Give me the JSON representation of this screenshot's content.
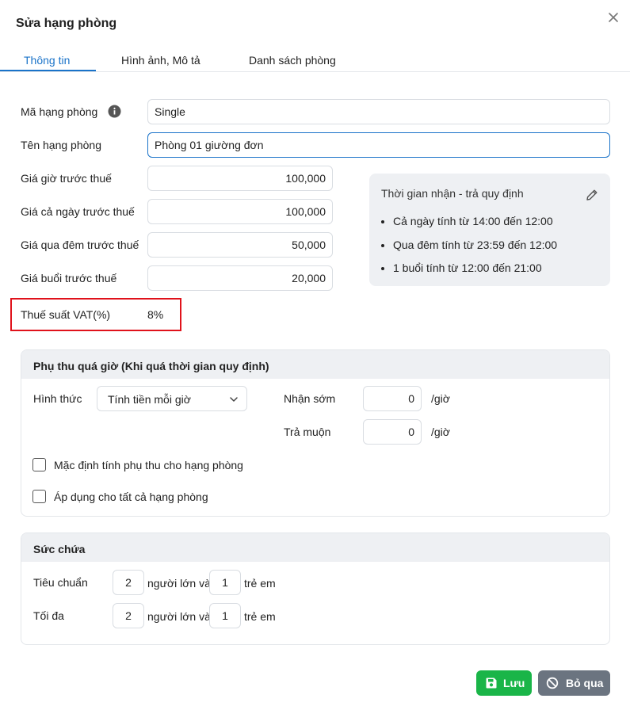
{
  "dialog": {
    "title": "Sửa hạng phòng"
  },
  "tabs": [
    {
      "label": "Thông tin"
    },
    {
      "label": "Hình ảnh, Mô tả"
    },
    {
      "label": "Danh sách phòng"
    }
  ],
  "form": {
    "code_label": "Mã hạng phòng",
    "code_value": "Single",
    "name_label": "Tên hạng phòng",
    "name_value": "Phòng 01 giường đơn",
    "hourly_label": "Giá giờ trước thuế",
    "hourly_value": "100,000",
    "daily_label": "Giá cả ngày trước thuế",
    "daily_value": "100,000",
    "overnight_label": "Giá qua đêm trước thuế",
    "overnight_value": "50,000",
    "session_label": "Giá buổi trước thuế",
    "session_value": "20,000",
    "vat_label": "Thuế suất VAT(%)",
    "vat_value": "8%"
  },
  "time_rules": {
    "title": "Thời gian nhận - trả quy định",
    "items": [
      "Cả ngày tính từ 14:00 đến 12:00",
      "Qua đêm tính từ 23:59 đến 12:00",
      "1 buổi tính từ 12:00 đến 21:00"
    ]
  },
  "surcharge": {
    "title": "Phụ thu quá giờ (Khi quá thời gian quy định)",
    "method_label": "Hình thức",
    "method_value": "Tính tiền mỗi giờ",
    "early_label": "Nhận sớm",
    "early_value": "0",
    "late_label": "Trả muộn",
    "late_value": "0",
    "unit": "/giờ",
    "default_check_label": "Mặc định tính phụ thu cho hạng phòng",
    "apply_all_label": "Áp dụng cho tất cả hạng phòng"
  },
  "capacity": {
    "title": "Sức chứa",
    "standard_label": "Tiêu chuẩn",
    "standard_adults": "2",
    "standard_children": "1",
    "max_label": "Tối đa",
    "max_adults": "2",
    "max_children": "1",
    "adults_text": "người lớn và",
    "children_text": "trẻ em"
  },
  "buttons": {
    "save": "Lưu",
    "cancel": "Bỏ qua"
  }
}
